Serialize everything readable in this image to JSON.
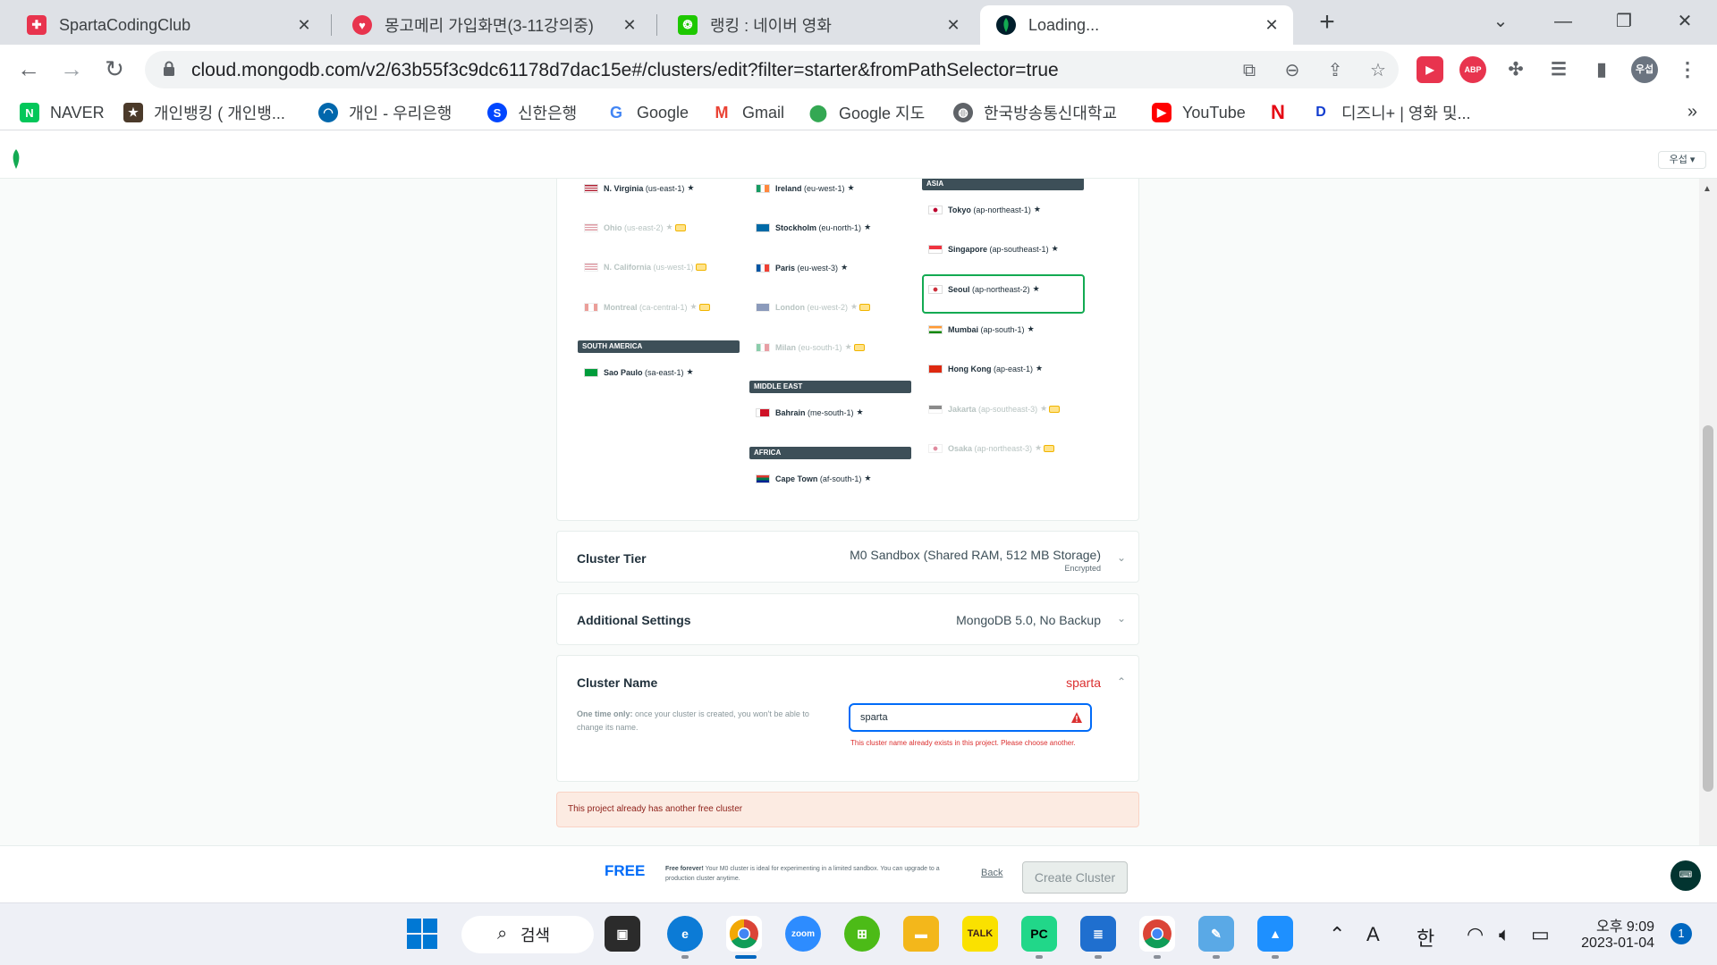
{
  "browser": {
    "tabs": [
      {
        "title": "SpartaCodingClub"
      },
      {
        "title": "몽고메리 가입화면(3-11강의중)"
      },
      {
        "title": "랭킹 : 네이버 영화"
      },
      {
        "title": "Loading..."
      }
    ],
    "url": "cloud.mongodb.com/v2/63b55f3c9dc61178d7dac15e#/clusters/edit?filter=starter&fromPathSelector=true",
    "profile_label": "우섭",
    "bookmarks": [
      {
        "label": "NAVER"
      },
      {
        "label": "개인뱅킹 ( 개인뱅..."
      },
      {
        "label": "개인 - 우리은행"
      },
      {
        "label": "신한은행"
      },
      {
        "label": "Google"
      },
      {
        "label": "Gmail"
      },
      {
        "label": "Google 지도"
      },
      {
        "label": "한국방송통신대학교"
      },
      {
        "label": "YouTube"
      },
      {
        "label": ""
      },
      {
        "label": "디즈니+ | 영화 및..."
      }
    ]
  },
  "header": {
    "user_menu": "우섭 ▾"
  },
  "regions": {
    "continents": {
      "south_america": "SOUTH AMERICA",
      "middle_east": "MIDDLE EAST",
      "africa": "AFRICA",
      "asia": "ASIA"
    },
    "americas": [
      {
        "name": "N. Virginia",
        "code": "(us-east-1)",
        "enabled": true
      },
      {
        "name": "Ohio",
        "code": "(us-east-2)",
        "enabled": false
      },
      {
        "name": "N. California",
        "code": "(us-west-1)",
        "enabled": false
      },
      {
        "name": "Montreal",
        "code": "(ca-central-1)",
        "enabled": false
      }
    ],
    "south_america": [
      {
        "name": "Sao Paulo",
        "code": "(sa-east-1)",
        "enabled": true
      }
    ],
    "europe": [
      {
        "name": "Ireland",
        "code": "(eu-west-1)",
        "enabled": true
      },
      {
        "name": "Stockholm",
        "code": "(eu-north-1)",
        "enabled": true
      },
      {
        "name": "Paris",
        "code": "(eu-west-3)",
        "enabled": true
      },
      {
        "name": "London",
        "code": "(eu-west-2)",
        "enabled": false
      },
      {
        "name": "Milan",
        "code": "(eu-south-1)",
        "enabled": false
      }
    ],
    "middle_east": [
      {
        "name": "Bahrain",
        "code": "(me-south-1)",
        "enabled": true
      }
    ],
    "africa": [
      {
        "name": "Cape Town",
        "code": "(af-south-1)",
        "enabled": true
      }
    ],
    "asia": [
      {
        "name": "Tokyo",
        "code": "(ap-northeast-1)",
        "enabled": true
      },
      {
        "name": "Singapore",
        "code": "(ap-southeast-1)",
        "enabled": true
      },
      {
        "name": "Seoul",
        "code": "(ap-northeast-2)",
        "enabled": true,
        "selected": true
      },
      {
        "name": "Mumbai",
        "code": "(ap-south-1)",
        "enabled": true
      },
      {
        "name": "Hong Kong",
        "code": "(ap-east-1)",
        "enabled": true
      },
      {
        "name": "Jakarta",
        "code": "(ap-southeast-3)",
        "enabled": false
      },
      {
        "name": "Osaka",
        "code": "(ap-northeast-3)",
        "enabled": false
      }
    ]
  },
  "cluster_tier": {
    "label": "Cluster Tier",
    "value": "M0 Sandbox (Shared RAM, 512 MB Storage)",
    "sub": "Encrypted"
  },
  "additional_settings": {
    "label": "Additional Settings",
    "value": "MongoDB 5.0, No Backup"
  },
  "cluster_name": {
    "label": "Cluster Name",
    "value": "sparta",
    "help_bold": "One time only:",
    "help_text": "once your cluster is created, you won't be able to change its name.",
    "input_value": "sparta",
    "error": "This cluster name already exists in this project. Please choose another."
  },
  "error_banner": "This project already has another free cluster",
  "footer": {
    "free_label": "FREE",
    "desc_bold": "Free forever!",
    "desc_text": "Your M0 cluster is ideal for experimenting in a limited sandbox. You can upgrade to a production cluster anytime.",
    "back": "Back",
    "create": "Create Cluster"
  },
  "taskbar": {
    "search_label": "검색",
    "ime_a": "A",
    "ime_han": "한",
    "time": "오후 9:09",
    "date": "2023-01-04",
    "notifications": "1"
  },
  "colors": {
    "accent_green": "#13aa52",
    "link_blue": "#016bf8",
    "error_red": "#db3030"
  }
}
